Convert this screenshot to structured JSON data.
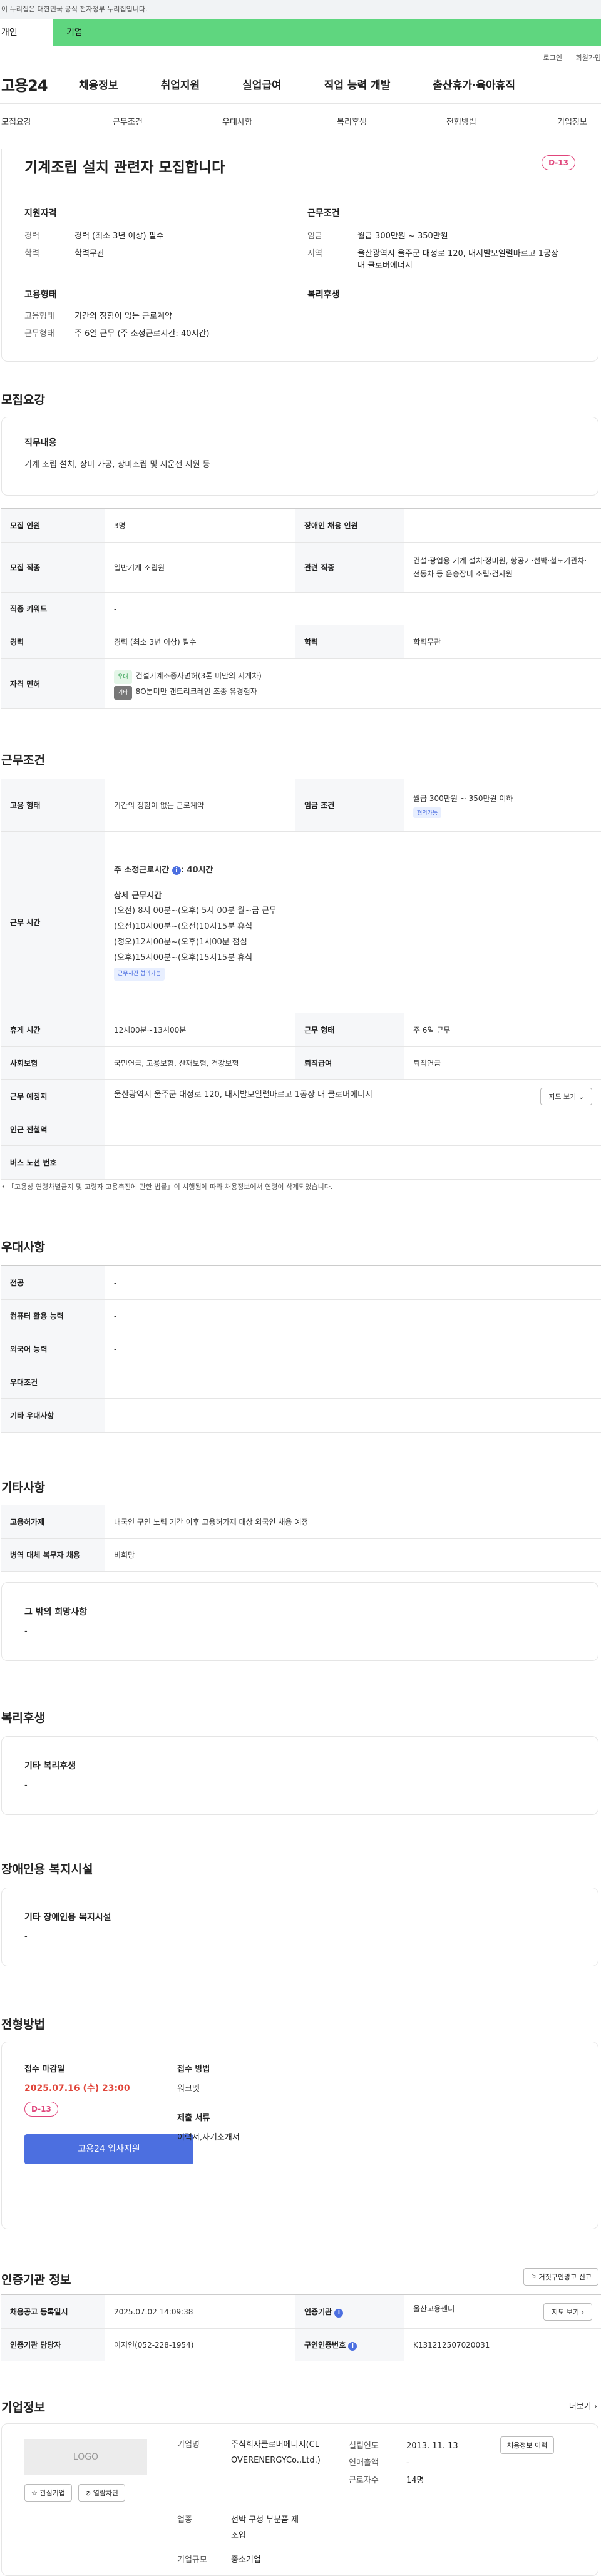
{
  "gov_bar": "이 누리집은 대한민국 공식 전자정부 누리집입니다.",
  "tabs": {
    "personal": "개인",
    "company": "기업"
  },
  "util": {
    "login": "로그인",
    "join": "회원가입"
  },
  "logo": "고용24",
  "gnb": [
    "채용정보",
    "취업지원",
    "실업급여",
    "직업 능력 개발",
    "출산휴가·육아휴직"
  ],
  "subtabs": [
    "모집요강",
    "근무조건",
    "우대사항",
    "복리후생",
    "전형방법",
    "기업정보"
  ],
  "hero": {
    "title": "기계조립 설치 관련자 모집합니다",
    "dday": "D-13",
    "qual_title": "지원자격",
    "qual": [
      {
        "k": "경력",
        "v": "경력 (최소 3년 이상) 필수"
      },
      {
        "k": "학력",
        "v": "학력무관"
      }
    ],
    "cond_title": "근무조건",
    "cond": [
      {
        "k": "임금",
        "v": "월급 300만원 ~ 350만원"
      },
      {
        "k": "지역",
        "v": "울산광역시 울주군 대정로 120, 내서발모일렬바르고 1공장 내 클로버에너지"
      }
    ],
    "emp_title": "고용형태",
    "emp": [
      {
        "k": "고용형태",
        "v": "기간의 정함이 없는 근로계약"
      },
      {
        "k": "근무형태",
        "v": "주 6일 근무 (주 소정근로시간: 40시간)"
      }
    ],
    "welfare_title": "복리후생"
  },
  "recruit": {
    "title": "모집요강",
    "duty_title": "직무내용",
    "duty": "기계 조립 설치, 장비 가공, 장비조립 및 시운전 지원 등",
    "rows": {
      "count_k": "모집 인원",
      "count_v": "3명",
      "disabled_k": "장애인 채용 인원",
      "disabled_v": "-",
      "job_k": "모집 직종",
      "job_v": "일반기계 조립원",
      "related_k": "관련 직종",
      "related_v": "건설·광업용 기계 설치·정비원, 항공기·선박·철도기관차·전동차 등 운송장비 조립·검사원",
      "keyword_k": "직종 키워드",
      "keyword_v": "-",
      "career_k": "경력",
      "career_v": "경력 (최소 3년 이상) 필수",
      "edu_k": "학력",
      "edu_v": "학력무관",
      "license_k": "자격 면허",
      "license1_chip": "우대",
      "license1": "건설기계조종사면허(3톤 미만의 지게차)",
      "license2_chip": "기타",
      "license2": "8O톤미만 갠트리크레인 조종 유경험자"
    }
  },
  "work": {
    "title": "근무조건",
    "type_k": "고용 형태",
    "type_v": "기간의 정함이 없는 근로계약",
    "wage_k": "임금 조건",
    "wage_v": "월급 300만원 ~ 350만원 이하",
    "wage_chip": "협의가능",
    "hours_k": "근무 시간",
    "hours_head": "주 소정근로시간",
    "hours_total": ": 40시간",
    "hours_detail_title": "상세 근무시간",
    "hours_lines": [
      "(오전) 8시 00분~(오후) 5시 00분 월~금 근무",
      "(오전)10시00분~(오전)10시15분 휴식",
      "(정오)12시00분~(오후)1시00분 점심",
      "(오후)15시00분~(오후)15시15분 휴식"
    ],
    "hours_chip": "근무시간 협의가능",
    "break_k": "휴게 시간",
    "break_v": "12시00분~13시00분",
    "form_k": "근무 형태",
    "form_v": "주 6일 근무",
    "insurance_k": "사회보험",
    "insurance_v": "국민연금, 고용보험, 산재보험, 건강보험",
    "retire_k": "퇴직급여",
    "retire_v": "퇴직연금",
    "place_k": "근무 예정지",
    "place_v": "울산광역시 울주군 대정로 120, 내서발모일렬바르고 1공장 내 클로버에너지",
    "map_btn": "지도 보기",
    "subway_k": "인근 전철역",
    "subway_v": "-",
    "bus_k": "버스 노선 번호",
    "bus_v": "-",
    "note": "「고용상 연령차별금지 및 고령자 고용촉진에 관한 법률」이 시행됨에 따라 채용정보에서 연령이 삭제되었습니다."
  },
  "pref": {
    "title": "우대사항",
    "rows": [
      {
        "k": "전공",
        "v": "-"
      },
      {
        "k": "컴퓨터 활용 능력",
        "v": "-"
      },
      {
        "k": "외국어 능력",
        "v": "-"
      },
      {
        "k": "우대조건",
        "v": "-"
      },
      {
        "k": "기타 우대사항",
        "v": "-"
      }
    ]
  },
  "etc": {
    "title": "기타사항",
    "foreign_k": "고용허가제",
    "foreign_v": "내국인 구인 노력 기간 이후 고용허가제 대상 외국인 채용 예정",
    "military_k": "병역 대체 복무자 채용",
    "military_v": "비희망",
    "other_title": "그 밖의 희망사항",
    "other_v": "-"
  },
  "welfare": {
    "title": "복리후생",
    "box_title": "기타 복리후생",
    "box_v": "-"
  },
  "disabled": {
    "title": "장애인용 복지시설",
    "box_title": "기타 장애인용 복지시설",
    "box_v": "-"
  },
  "process": {
    "title": "전형방법",
    "deadline_k": "접수 마감일",
    "deadline_v": "2025.07.16 (수) 23:00",
    "dday": "D-13",
    "apply_btn": "고용24 입사지원",
    "method_k": "접수 방법",
    "method_v": "워크넷",
    "docs_k": "제출 서류",
    "docs_v": "이력서,자기소개서"
  },
  "cert": {
    "title": "인증기관 정보",
    "report_btn": "거짓구인광고 신고",
    "reg_k": "채용공고 등록일시",
    "reg_v": "2025.07.02 14:09:38",
    "org_k": "인증기관",
    "org_v": "울산고용센터",
    "org_map": "지도 보기",
    "manager_k": "인증기관 담당자",
    "manager_v": "이지연(052-228-1954)",
    "no_k": "구인인증번호",
    "no_v": "K131212507020031"
  },
  "company": {
    "title": "기업정보",
    "more": "더보기",
    "logo": "LOGO",
    "fav_btn": "관심기업",
    "block_btn": "열람차단",
    "name_k": "기업명",
    "name_v": "주식회사클로버에너지(CLOVERENERGYCo.,Ltd.)",
    "founded_k": "설립연도",
    "founded_v": "2013. 11. 13",
    "sales_k": "연매출액",
    "sales_v": "-",
    "staff_k": "근로자수",
    "staff_v": "14명",
    "jobs_btn": "채용정보 이력",
    "industry_k": "업종",
    "industry_v": "선박 구성 부분품 제조업",
    "scale_k": "기업규모",
    "scale_v": "중소기업"
  }
}
